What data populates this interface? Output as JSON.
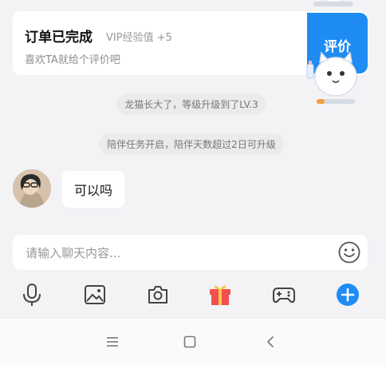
{
  "order_card": {
    "title": "订单已完成",
    "vip": "VIP经验值 +5",
    "subtitle": "喜欢TA就给个评价吧",
    "rate_label": "评价"
  },
  "system_messages": [
    "龙猫长大了，等级升级到了LV.3",
    "陪伴任务开启，陪伴天数超过2日可升级"
  ],
  "chat": {
    "message": "可以吗"
  },
  "input": {
    "placeholder": "请输入聊天内容..."
  },
  "toolbar": {
    "icons": [
      "microphone-icon",
      "image-icon",
      "camera-icon",
      "gift-icon",
      "gamepad-icon",
      "plus-icon"
    ]
  },
  "colors": {
    "accent": "#1e8cf3",
    "gift_red": "#f0504f",
    "gift_yellow": "#f7c948"
  }
}
